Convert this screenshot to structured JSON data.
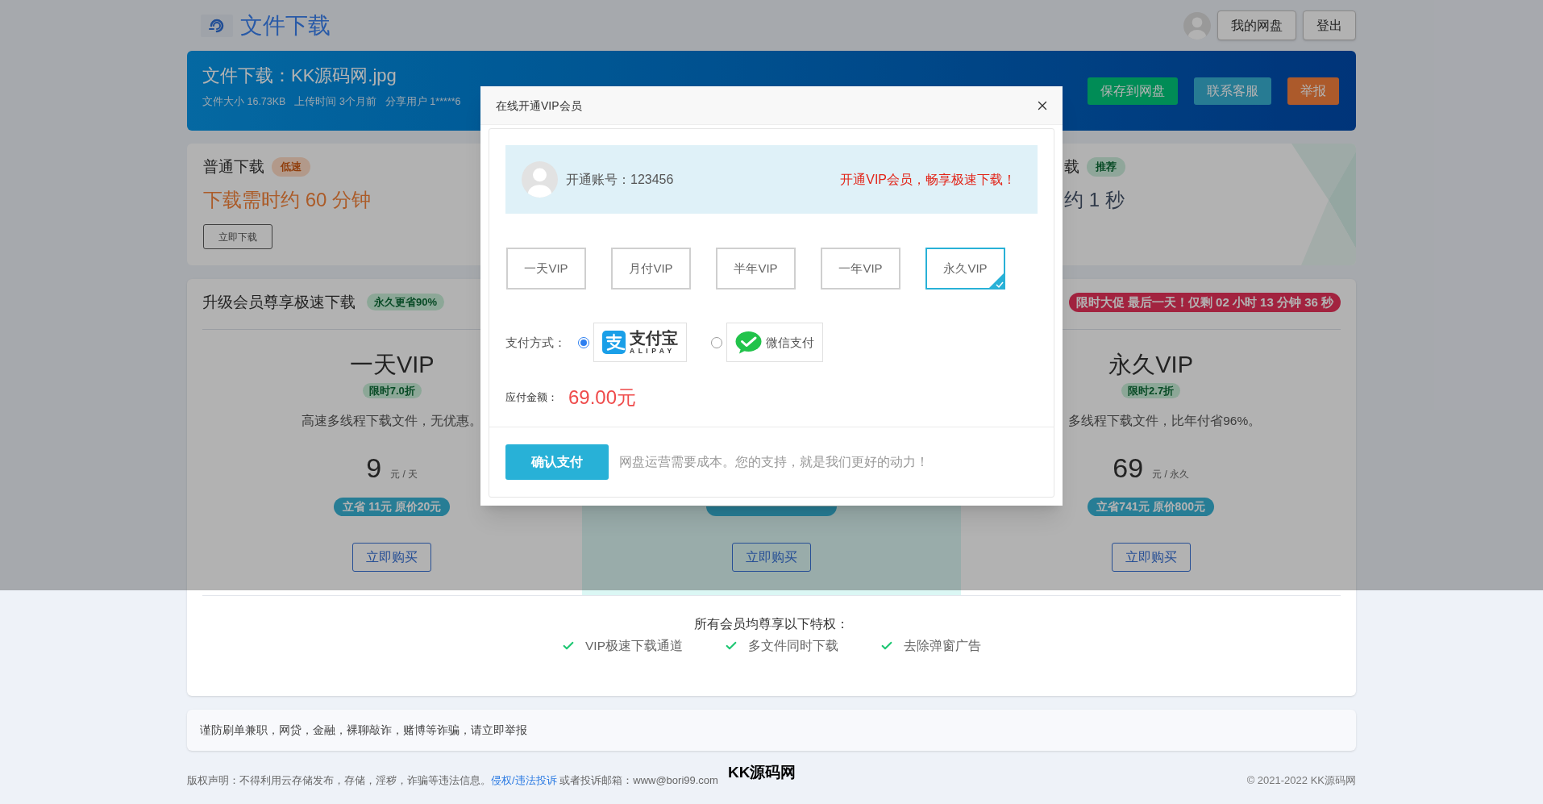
{
  "header": {
    "title": "文件下载",
    "buttons": [
      "我的网盘",
      "登出"
    ]
  },
  "file_banner": {
    "title": "文件下载：KK源码网.jpg",
    "meta": [
      "文件大小 16.73KB",
      "上传时间 3个月前",
      "分享用户 1*****6"
    ],
    "buttons": [
      {
        "label": "保存到网盘",
        "kind": "save"
      },
      {
        "label": "联系客服",
        "kind": "contact"
      },
      {
        "label": "举报",
        "kind": "report"
      }
    ]
  },
  "download_options": [
    {
      "kind": "normal",
      "title": "普通下载",
      "tag": "低速",
      "time": "下载需时约 60 分钟",
      "button": "立即下载"
    },
    {
      "kind": "fast",
      "title": "载",
      "tag": "推荐",
      "time": "约 1 秒"
    }
  ],
  "vip_section": {
    "title": "升级会员尊享极速下载",
    "tag": "永久更省90%",
    "promo": "限时大促 最后一天！仅剩 02 小时 13 分钟 36 秒",
    "plans": [
      {
        "name": "一天VIP",
        "discount": "限时7.0折",
        "description": "高速多线程下载文件，无优惠。",
        "price": "9",
        "unit": "元 / 天",
        "saving": "立省 11元 原价20元",
        "button": "立即购买",
        "highlighted": false
      },
      {
        "highlighted": true,
        "saving_covered": true,
        "button": "立即购买"
      },
      {
        "name": "永久VIP",
        "discount": "限时2.7折",
        "description": "多线程下载文件，比年付省96%。",
        "price": "69",
        "unit": "元 / 永久",
        "saving": "立省741元 原价800元",
        "button": "立即购买",
        "highlighted": false
      }
    ],
    "perks_title": "所有会员均尊享以下特权：",
    "perks": [
      "VIP极速下载通道",
      "多文件同时下载",
      "去除弹窗广告"
    ]
  },
  "notice": "谨防刷单兼职，网贷，金融，裸聊敲诈，赌博等诈骗，请立即举报",
  "footer": {
    "statement": "版权声明：不得利用云存储发布，存储，淫秽，诈骗等违法信息。",
    "link": "侵权/违法投诉",
    "contact": "或者投诉邮箱：www@bori99.com",
    "logo": "KK源码网",
    "copyright": "© 2021-2022 KK源码网"
  },
  "modal": {
    "title": "在线开通VIP会员",
    "account": "开通账号：123456",
    "promo": "开通VIP会员，畅享极速下载！",
    "plans": [
      {
        "label": "一天VIP",
        "selected": false
      },
      {
        "label": "月付VIP",
        "selected": false
      },
      {
        "label": "半年VIP",
        "selected": false
      },
      {
        "label": "一年VIP",
        "selected": false
      },
      {
        "label": "永久VIP",
        "selected": true
      }
    ],
    "payment_label": "支付方式：",
    "payment_methods": [
      {
        "kind": "alipay",
        "name": "支付宝",
        "subtitle": "ALIPAY",
        "selected": true
      },
      {
        "kind": "wechat",
        "name": "微信支付",
        "selected": false
      }
    ],
    "amount_label": "应付金额：",
    "amount": "69.00元",
    "confirm": "确认支付",
    "note": "网盘运营需要成本。您的支持，就是我们更好的动力！"
  }
}
